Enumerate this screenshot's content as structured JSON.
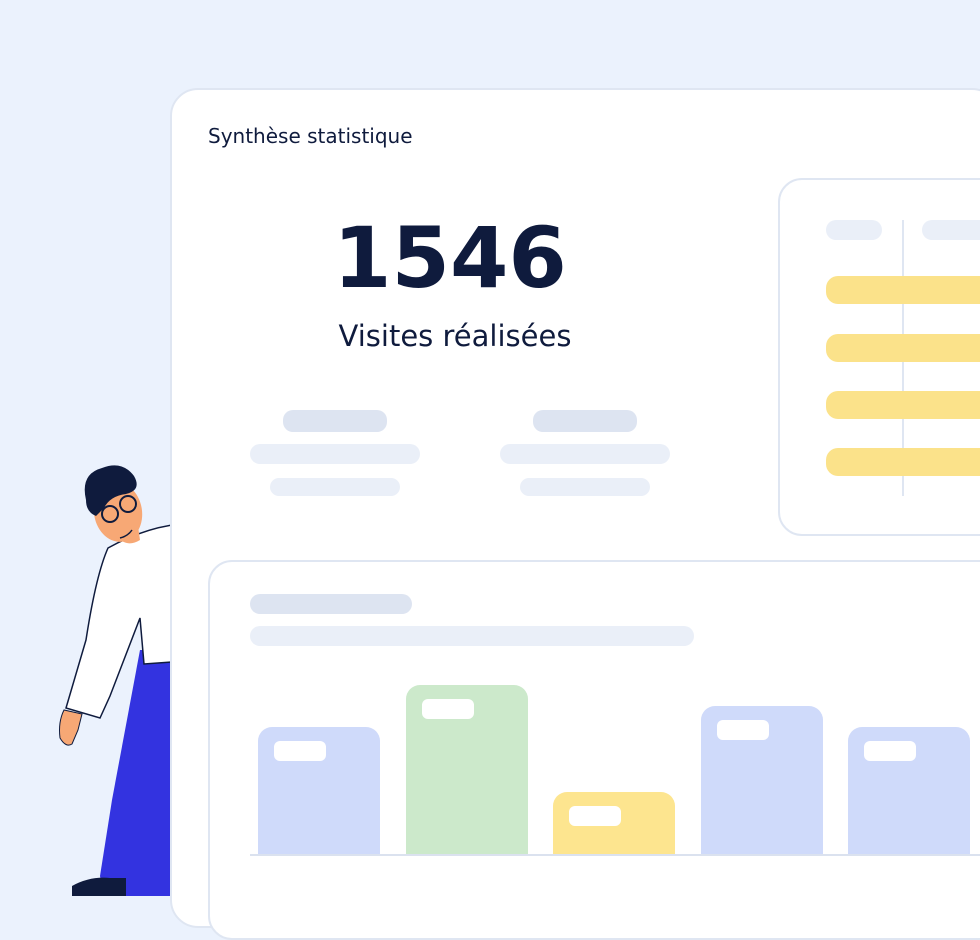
{
  "panel": {
    "title": "Synthèse statistique"
  },
  "kpi": {
    "value": "1546",
    "label": "Visites réalisées"
  },
  "chart_data": {
    "type": "bar",
    "title": "",
    "categories": [
      "",
      "",
      "",
      "",
      ""
    ],
    "values": [
      3,
      4,
      1.5,
      3.5,
      3
    ],
    "colors": [
      "#cfdafa",
      "#cce9cb",
      "#fde58f",
      "#cfdafa",
      "#cfdafa"
    ],
    "ylim": [
      0,
      4.2
    ]
  },
  "colors": {
    "background": "#ebf2fd",
    "text": "#0f1b3d",
    "accent_yellow": "#fbe28a",
    "trousers": "#3333e0"
  }
}
